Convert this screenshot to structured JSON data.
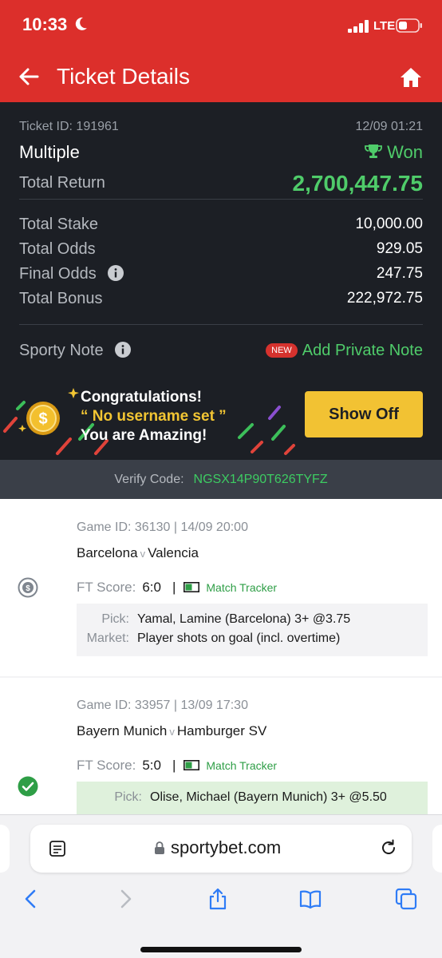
{
  "status_bar": {
    "time": "10:33",
    "network": "LTE"
  },
  "header": {
    "title": "Ticket Details"
  },
  "ticket": {
    "id_label": "Ticket ID: 191961",
    "datetime": "12/09 01:21",
    "type": "Multiple",
    "status": "Won",
    "total_return_label": "Total Return",
    "total_return": "2,700,447.75",
    "rows": [
      {
        "label": "Total Stake",
        "value": "10,000.00"
      },
      {
        "label": "Total Odds",
        "value": "929.05"
      },
      {
        "label": "Final Odds",
        "value": "247.75"
      },
      {
        "label": "Total Bonus",
        "value": "222,972.75"
      }
    ],
    "note_label": "Sporty Note",
    "new_badge": "NEW",
    "add_note_label": "Add Private Note"
  },
  "promo": {
    "line1": "Congratulations!",
    "line2": "“ No username set ”",
    "line3": "You are Amazing!",
    "button_label": "Show Off"
  },
  "verify": {
    "label": "Verify Code:",
    "code": "NGSX14P90T626TYFZ"
  },
  "games": [
    {
      "meta": "Game ID: 36130 | 14/09 20:00",
      "home": "Barcelona",
      "vs": "v",
      "away": "Valencia",
      "score_label": "FT Score:",
      "score": "6:0",
      "separator": "|",
      "tracker_label": "Match Tracker",
      "pick_label": "Pick:",
      "pick": "Yamal, Lamine (Barcelona) 3+ @3.75",
      "market_label": "Market:",
      "market": "Player shots on goal (incl. overtime)",
      "status_icon": "cashout-coin-icon"
    },
    {
      "meta": "Game ID: 33957 | 13/09 17:30",
      "home": "Bayern Munich",
      "vs": "v",
      "away": "Hamburger SV",
      "score_label": "FT Score:",
      "score": "5:0",
      "separator": "|",
      "tracker_label": "Match Tracker",
      "pick_label": "Pick:",
      "pick": "Olise, Michael (Bayern Munich) 3+ @5.50",
      "status_icon": "won-check-icon"
    }
  ],
  "browser": {
    "url": "sportybet.com"
  },
  "colors": {
    "brand_red": "#dc2f2b",
    "won_green": "#4fcc6a",
    "dark_bg": "#1c1f25",
    "button_yellow": "#f2c233"
  }
}
